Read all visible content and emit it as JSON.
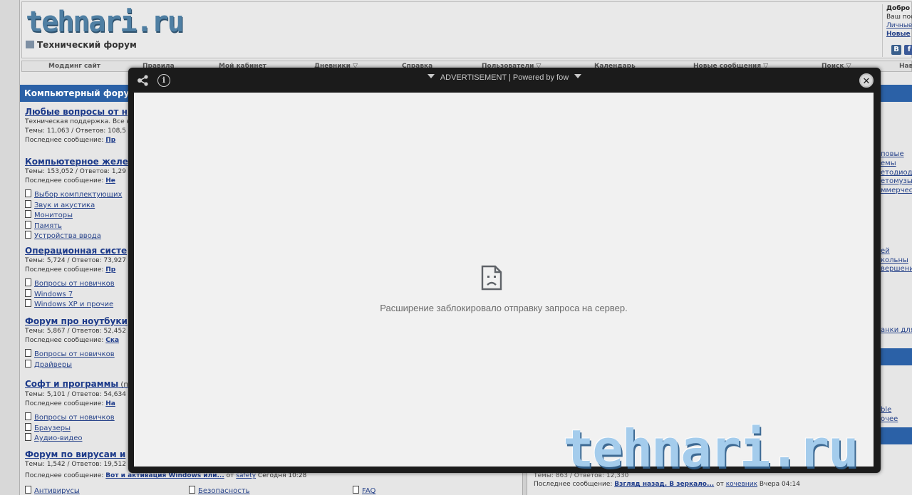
{
  "site": {
    "logo": "tehnari.ru",
    "tagline": "Технический форум",
    "welcome": {
      "greeting": "Добро п",
      "line2": "Ваш пос",
      "link1": "Личные",
      "link2": "Новые",
      "vk": "B",
      "fb": "f"
    }
  },
  "navbar": {
    "items": [
      "Моддинг сайт",
      "Правила",
      "Мой кабинет",
      "Дневники ▽",
      "Справка",
      "Пользователи ▽",
      "Календарь",
      "Новые сообщения ▽",
      "Поиск ▽",
      "Нав"
    ]
  },
  "category": {
    "title": "Компьютерный фору"
  },
  "forums": [
    {
      "title": "Любые вопросы от н",
      "desc": "Техническая поддержка. Все в",
      "stats": "Темы: 11,063 / Ответов: 108,5",
      "last": "Последнее сообщение:",
      "last_link": "Пр",
      "subs": []
    },
    {
      "title": "Компьютерное желе",
      "desc": "",
      "stats": "Темы: 153,052 / Ответов: 1,29",
      "last": "Последнее сообщение:",
      "last_link": "Не",
      "subs": [
        "Выбор комплектующих",
        "Звук и акустика",
        "Мониторы",
        "Память",
        "Устройства ввода"
      ]
    },
    {
      "title": "Операционная систе",
      "desc": "",
      "stats": "Темы: 5,724 / Ответов: 73,927",
      "last": "Последнее сообщение:",
      "last_link": "Пр",
      "subs": [
        "Вопросы от новичков",
        "Windows 7",
        "Windows XP и прочие"
      ]
    },
    {
      "title": "Форум про ноутбуки",
      "desc": "",
      "stats": "Темы: 5,867 / Ответов: 52,452",
      "last": "Последнее сообщение:",
      "last_link": "Ска",
      "subs": [
        "Вопросы от новичков",
        "Драйверы"
      ]
    },
    {
      "title": "Софт и программы",
      "title_suffix": " (п",
      "desc": "",
      "stats": "Темы: 5,101 / Ответов: 54,634",
      "last": "Последнее сообщение:",
      "last_link": "На",
      "subs": [
        "Вопросы от новичков",
        "Браузеры",
        "Аудио-видео"
      ]
    },
    {
      "title": "Форум по вирусам и",
      "desc": "",
      "stats": "Темы: 1,542 / Ответов: 19,512",
      "last": "",
      "last_link": "",
      "subs": []
    }
  ],
  "right_col": [
    "повые",
    "емы",
    "етодиод",
    "етомузы",
    "ммерчес",
    "ей",
    "кольны",
    "вершени",
    "анки для",
    "ble",
    "очее"
  ],
  "bottom": {
    "left_last_prefix": "Последнее сообщение:",
    "left_last_link": "Вот и активация Windows или...",
    "left_last_by": "от",
    "left_last_user": "safety",
    "left_last_time": "Сегодня 10:28",
    "links": [
      "Антивирусы",
      "Безопасность",
      "FAQ"
    ],
    "right_stats": "Темы: 863 / Ответов: 12,330",
    "right_last_prefix": "Последнее сообщение:",
    "right_last_link": "Взгляд назад. В зеркало...",
    "right_last_by": "от",
    "right_last_user": "кочевник",
    "right_last_time": "Вчера 04:14"
  },
  "modal": {
    "ad_label": "ADVERTISEMENT | Powered by fow",
    "info_glyph": "i",
    "close_glyph": "✕",
    "blocked_message": "Расширение заблокировало отправку запроса на сервер."
  },
  "watermark": "tehnari.ru"
}
